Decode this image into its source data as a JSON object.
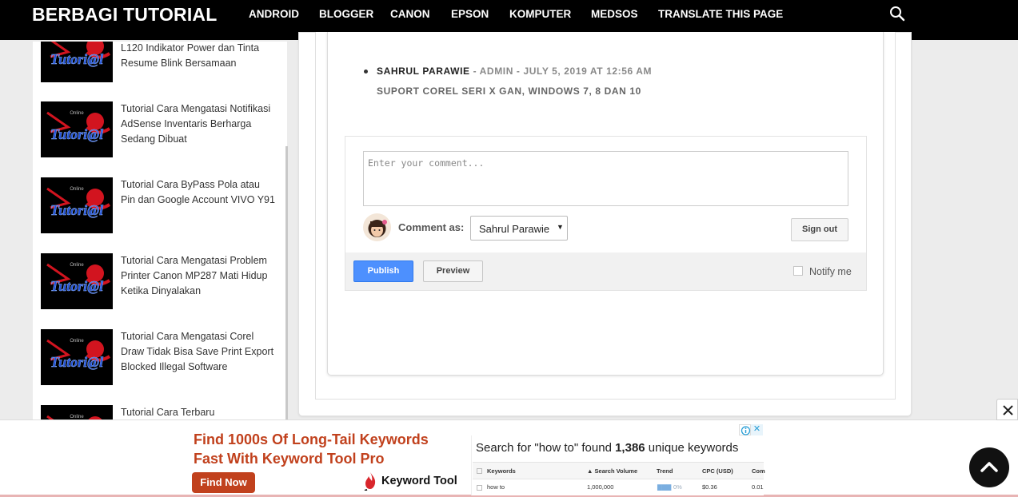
{
  "header": {
    "brand": "BERBAGI TUTORIAL",
    "nav": [
      "ANDROID",
      "BLOGGER",
      "CANON",
      "EPSON",
      "KOMPUTER",
      "MEDSOS",
      "TRANSLATE THIS PAGE"
    ],
    "search_icon": "search-icon"
  },
  "sidebar": {
    "thumb_logo_text": "Tutori@l",
    "thumb_logo_small": "Online",
    "posts": [
      {
        "title": "L120 Indikator Power dan Tinta Resume Blink Bersamaan"
      },
      {
        "title": "Tutorial Cara Mengatasi Notifikasi AdSense Inventaris Berharga Sedang Dibuat"
      },
      {
        "title": "Tutorial Cara ByPass Pola atau Pin dan Google Account VIVO Y91"
      },
      {
        "title": "Tutorial Cara Mengatasi Problem Printer Canon MP287 Mati Hidup Ketika Dinyalakan"
      },
      {
        "title": "Tutorial Cara Mengatasi Corel Draw Tidak Bisa Save Print Export Blocked Illegal Software"
      },
      {
        "title": "Tutorial Cara Terbaru"
      }
    ]
  },
  "reply": {
    "author": "SAHRUL PARAWIE",
    "meta": " - ADMIN - JULY 5, 2019 AT 12:56 AM",
    "text": "SUPORT COREL SERI X GAN, WINDOWS 7, 8 DAN 10"
  },
  "comment_form": {
    "placeholder": "Enter your comment...",
    "comment_as_label": "Comment as:",
    "identity": "Sahrul Parawie",
    "sign_out": "Sign out",
    "publish": "Publish",
    "preview": "Preview",
    "notify": "Notify me"
  },
  "ad": {
    "headline_1": "Find 1000s Of Long-Tail Keywords",
    "headline_2": "Fast With Keyword Tool Pro",
    "cta": "Find Now",
    "brand": "Keyword Tool",
    "shot_title_prefix": "Search for \"how to\" found ",
    "shot_title_count": "1,386",
    "shot_title_suffix": " unique keywords",
    "table_headers": [
      "Keywords",
      "Search Volume",
      "Trend",
      "CPC (USD)",
      "Com"
    ],
    "row": {
      "keyword": "how to",
      "volume": "1,000,000",
      "trend": "0%",
      "cpc": "$0.36",
      "com": "0.01"
    }
  },
  "colors": {
    "accent_blue": "#4d90fe",
    "ad_red": "#c1411d",
    "header_bg": "#000000"
  }
}
